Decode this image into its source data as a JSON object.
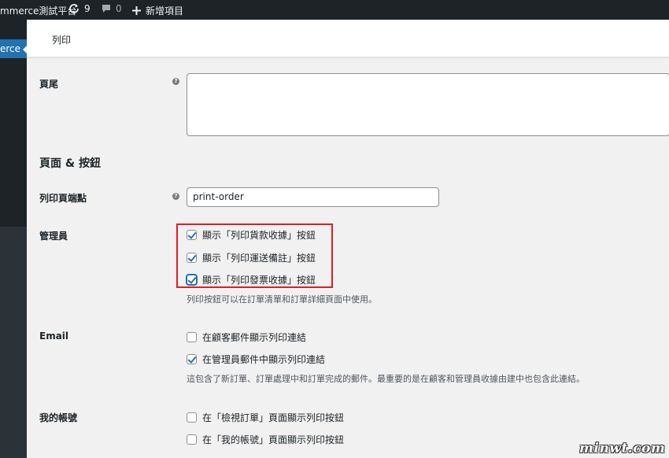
{
  "admin_bar": {
    "site_name": "mmerce測試平台",
    "updates_count": "9",
    "comments_count": "0",
    "new_label": "新增項目"
  },
  "sidebar": {
    "active_item": "erce"
  },
  "header": {
    "title": "列印"
  },
  "fields": {
    "footer_label": "頁尾",
    "footer_value": "",
    "section_title": "頁面 & 按鈕",
    "endpoint_label": "列印頁端點",
    "endpoint_value": "print-order",
    "admin_label": "管理員",
    "admin_options": [
      {
        "label": "顯示「列印貨款收據」按鈕",
        "checked": true
      },
      {
        "label": "顯示「列印運送備註」按鈕",
        "checked": true
      },
      {
        "label": "顯示「列印發票收據」按鈕",
        "checked": true
      }
    ],
    "admin_desc": "列印按鈕可以在訂單清單和訂單詳細頁面中使用。",
    "email_label": "Email",
    "email_options": [
      {
        "label": "在顧客郵件顯示列印連結",
        "checked": false
      },
      {
        "label": "在管理員郵件中顯示列印連結",
        "checked": true
      }
    ],
    "email_desc": "這包含了新訂單、訂單處理中和訂單完成的郵件。最重要的是在顧客和管理員收據由建中也包含此連結。",
    "account_label": "我的帳號",
    "account_options": [
      {
        "label": "在「檢視訂單」頁面顯示列印按鈕",
        "checked": false
      },
      {
        "label": "在「我的帳號」頁面顯示列印按鈕",
        "checked": false
      }
    ]
  },
  "help_glyph": "?",
  "watermark": "minwt.com",
  "colors": {
    "admin_bar": "#1d2327",
    "menu_active": "#2271b1",
    "highlight_box": "#e31b23",
    "checkbox_check": "#2271b1"
  }
}
